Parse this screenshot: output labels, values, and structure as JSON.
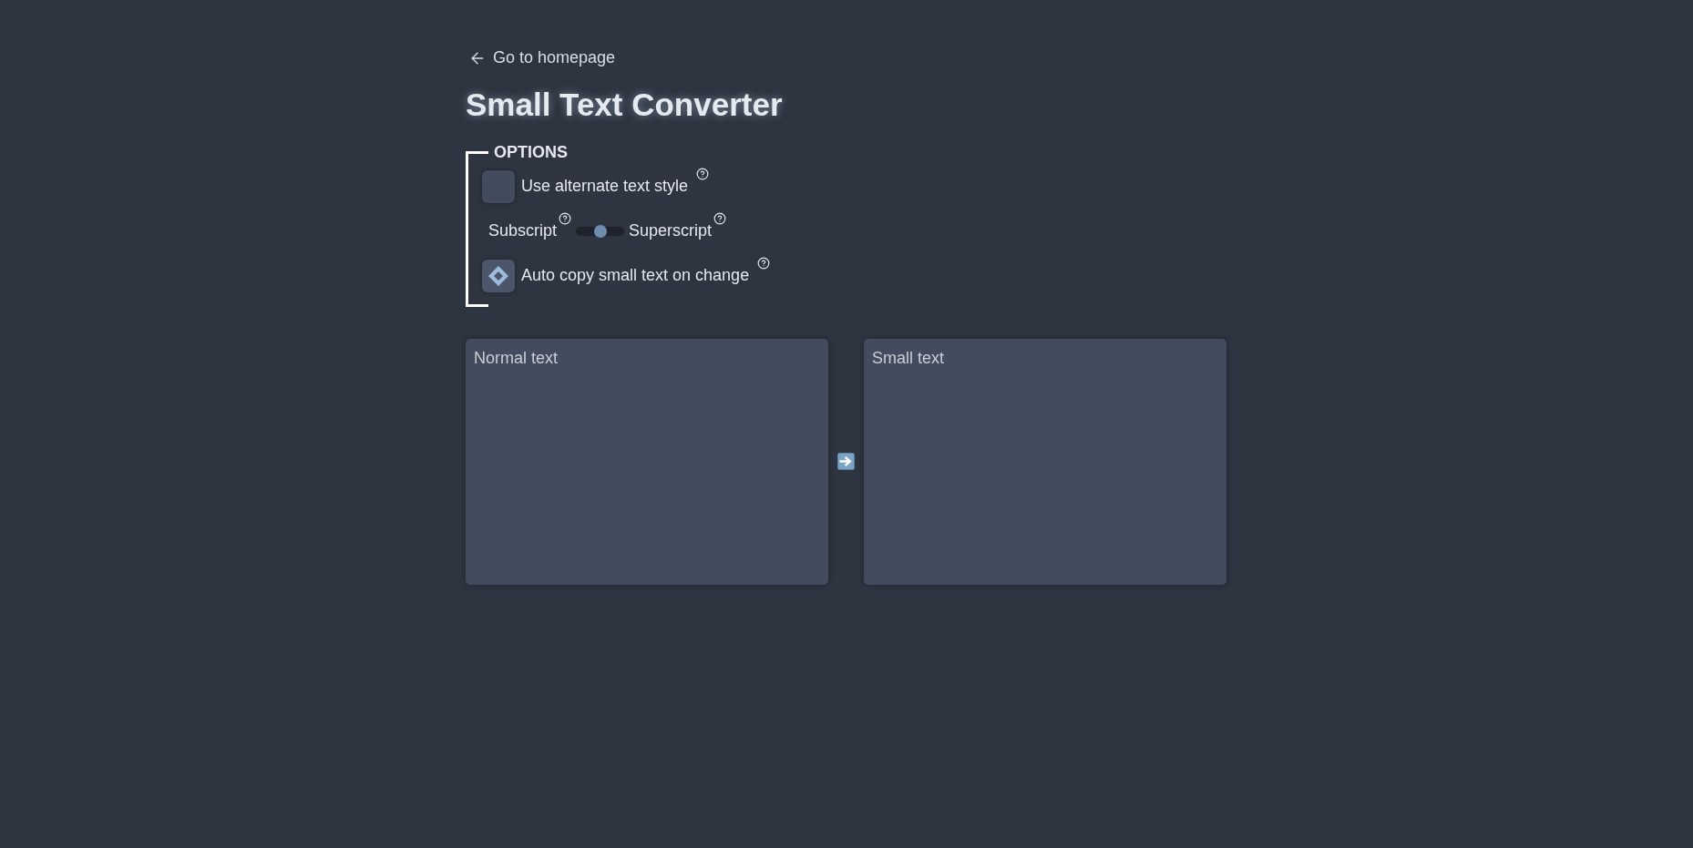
{
  "back_link": {
    "label": "Go to homepage"
  },
  "title": "Small Text Converter",
  "options": {
    "heading": "OPTIONS",
    "items": [
      {
        "kind": "checkbox",
        "label": "Use alternate text style",
        "checked": false
      },
      {
        "kind": "switch",
        "left_label": "Subscript",
        "right_label": "Superscript",
        "level": 0.5
      },
      {
        "kind": "checkbox",
        "label": "Auto copy small text on change",
        "checked": true
      }
    ]
  },
  "converter": {
    "input": {
      "placeholder": "Normal text"
    },
    "output": {
      "placeholder": "Small text"
    }
  }
}
